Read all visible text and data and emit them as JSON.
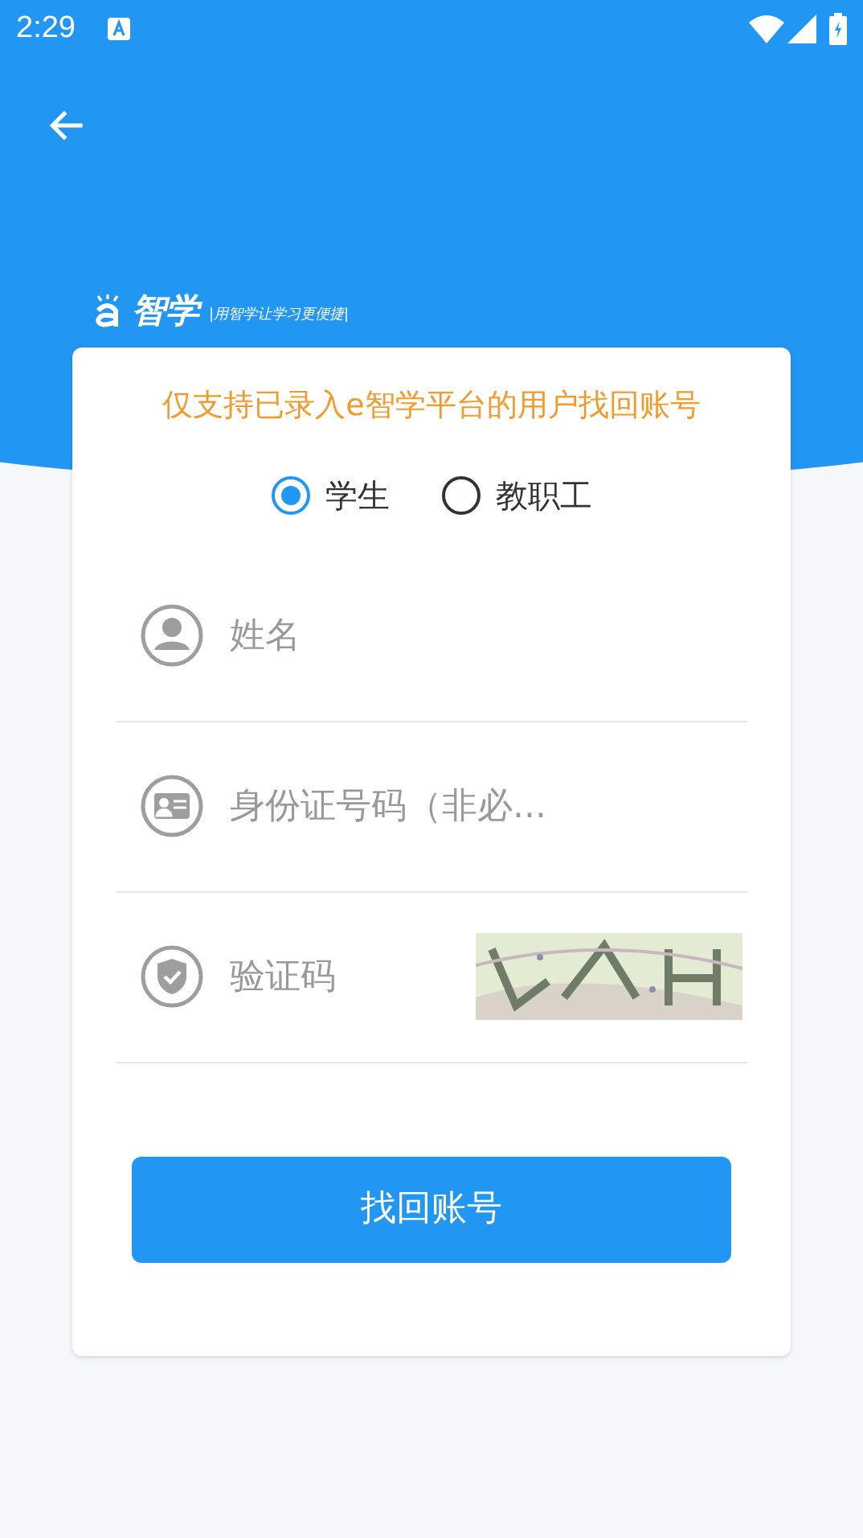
{
  "status_bar": {
    "time": "2:29"
  },
  "logo": {
    "name": "智学",
    "slogan": "|用智学让学习更便捷|"
  },
  "notice": "仅支持已录入e智学平台的用户找回账号",
  "roles": [
    {
      "label": "学生",
      "selected": true
    },
    {
      "label": "教职工",
      "selected": false
    }
  ],
  "fields": [
    {
      "kind": "person",
      "placeholder": "姓名"
    },
    {
      "kind": "id",
      "placeholder": "身份证号码（非必..."
    },
    {
      "kind": "captcha",
      "placeholder": "验证码"
    }
  ],
  "submit": "找回账号"
}
